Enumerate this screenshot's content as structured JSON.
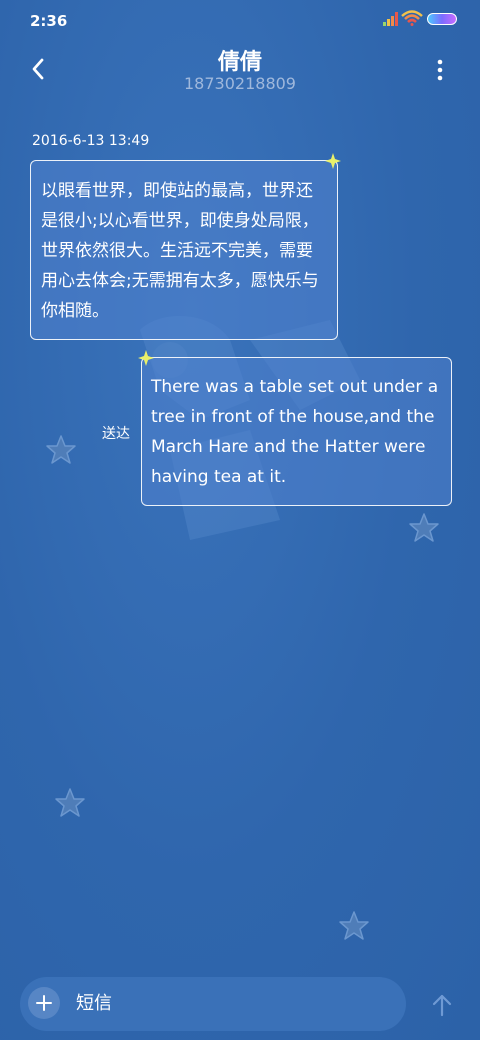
{
  "status_bar": {
    "time": "2:36"
  },
  "header": {
    "contact_name": "倩倩",
    "phone_number": "18730218809"
  },
  "conversation": {
    "timestamp": "2016-6-13 13:49",
    "messages": [
      {
        "direction": "incoming",
        "text": "以眼看世界，即使站的最高，世界还是很小;以心看世界，即使身处局限，世界依然很大。生活远不完美，需要用心去体会;无需拥有太多，愿快乐与你相随。"
      },
      {
        "direction": "outgoing",
        "text": "There was a table set out under a tree in front of the house,and the March Hare and the Hatter were having tea at it.",
        "status": "送达"
      }
    ]
  },
  "composer": {
    "placeholder": "短信"
  },
  "icons": {
    "back": "chevron-left-icon",
    "more": "more-vertical-icon",
    "add": "plus-icon",
    "send": "arrow-up-icon",
    "signal": "signal-icon",
    "wifi": "wifi-icon",
    "battery": "battery-icon"
  },
  "colors": {
    "background": "#2f66ad",
    "subtitle": "#9fb8dc",
    "star": "#e9f06a",
    "deco_star": "#4f7db8"
  }
}
